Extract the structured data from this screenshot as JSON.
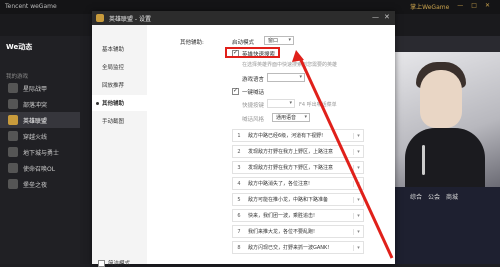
{
  "titlebar": {
    "brand": "Tencent weGame",
    "user": "掌上WeGame"
  },
  "sidebar": {
    "header": "We动态",
    "section": "我的游戏",
    "items": [
      "星际战甲",
      "部落冲突",
      "英雄联盟",
      "穿越火线",
      "地下城与勇士",
      "使命召唤OL",
      "堡垒之夜"
    ],
    "active_index": 2
  },
  "dialog": {
    "title": "英雄联盟 - 设置",
    "nav": [
      "基本辅助",
      "全局监控",
      "回放推荐",
      "其他辅助",
      "手动截图"
    ],
    "active_nav": 3,
    "nav_footer": "简洁模式",
    "section_label": "其他辅助:",
    "launch_mode": {
      "label": "启动模式",
      "value": "窗口"
    },
    "quick_search": {
      "label": "英雄快速搜索",
      "checked": true,
      "hint": "在选择英雄界面中快速搜索到您需要的英雄"
    },
    "game_language": {
      "label": "游戏语言"
    },
    "one_key_msg": {
      "label": "一键喊话",
      "checked": true
    },
    "hotkey": {
      "label": "快捷按键",
      "hint": "F4 呼出喊话菜单"
    },
    "tone": {
      "label": "喊话风格",
      "value": "通用语音"
    },
    "messages": [
      "敌方中路已经6级，河道有下视野!",
      "发现敌方打野在我方上野区，上路注意",
      "发现敌方打野在我方下野区，下路注意",
      "敌方中路消失了，各位注意!",
      "敌方可能在推小龙，中路和下路准备",
      "快来，我们团一波，乘胜追击!",
      "我们来推大龙，各位不要乱跑!",
      "敌方闪现已交，打野来抓一波GANK!"
    ]
  },
  "right_panel": {
    "tabs": [
      "综合",
      "公会",
      "商城"
    ]
  },
  "colors": {
    "highlight": "#e0201a",
    "accent": "#c89b3c"
  }
}
